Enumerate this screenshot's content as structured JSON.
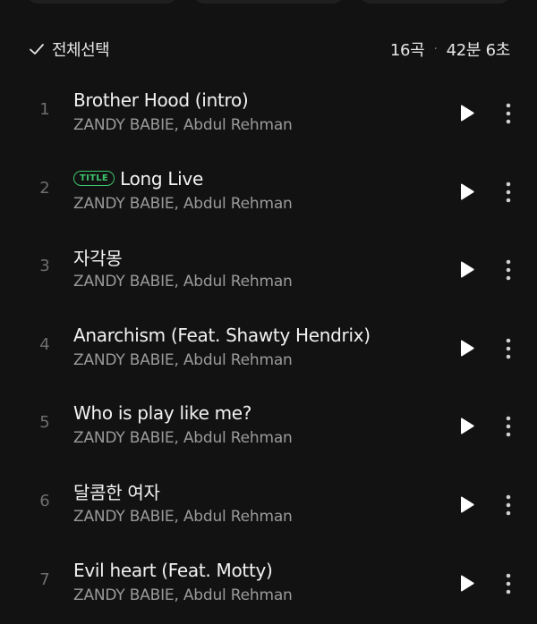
{
  "header": {
    "select_all_label": "전체선택",
    "track_count": "16곡",
    "duration": "42분 6초"
  },
  "title_badge_label": "TITLE",
  "tracks": [
    {
      "number": "1",
      "title": "Brother Hood (intro)",
      "artist": "ZANDY BABIE, Abdul Rehman",
      "is_title": false
    },
    {
      "number": "2",
      "title": "Long Live",
      "artist": "ZANDY BABIE, Abdul Rehman",
      "is_title": true
    },
    {
      "number": "3",
      "title": "자각몽",
      "artist": "ZANDY BABIE, Abdul Rehman",
      "is_title": false
    },
    {
      "number": "4",
      "title": "Anarchism (Feat. Shawty Hendrix)",
      "artist": "ZANDY BABIE, Abdul Rehman",
      "is_title": false
    },
    {
      "number": "5",
      "title": "Who is play like me?",
      "artist": "ZANDY BABIE, Abdul Rehman",
      "is_title": false
    },
    {
      "number": "6",
      "title": "달콤한 여자",
      "artist": "ZANDY BABIE, Abdul Rehman",
      "is_title": false
    },
    {
      "number": "7",
      "title": "Evil heart (Feat. Motty)",
      "artist": "ZANDY BABIE, Abdul Rehman",
      "is_title": false
    }
  ],
  "colors": {
    "background": "#121212",
    "accent_green": "#3ec46d",
    "secondary_text": "#9a9a9a"
  },
  "icons": {
    "check": "check-icon",
    "play": "play-icon",
    "more": "more-vertical-icon"
  }
}
